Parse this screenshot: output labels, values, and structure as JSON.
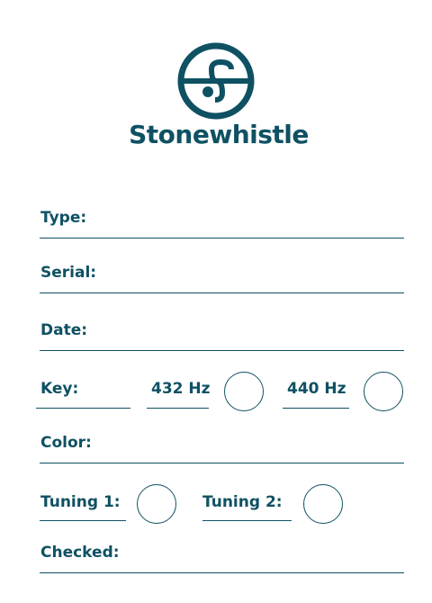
{
  "brand": {
    "name": "Stonewhistle",
    "color": "#0f5163",
    "logo_icon": "stonewhistle-s-logo-icon"
  },
  "form": {
    "type_label": "Type:",
    "serial_label": "Serial:",
    "date_label": "Date:",
    "key_label": "Key:",
    "hz432_label": "432 Hz",
    "hz440_label": "440 Hz",
    "color_label": "Color:",
    "tuning1_label": "Tuning 1:",
    "tuning2_label": "Tuning 2:",
    "checked_label": "Checked:"
  }
}
